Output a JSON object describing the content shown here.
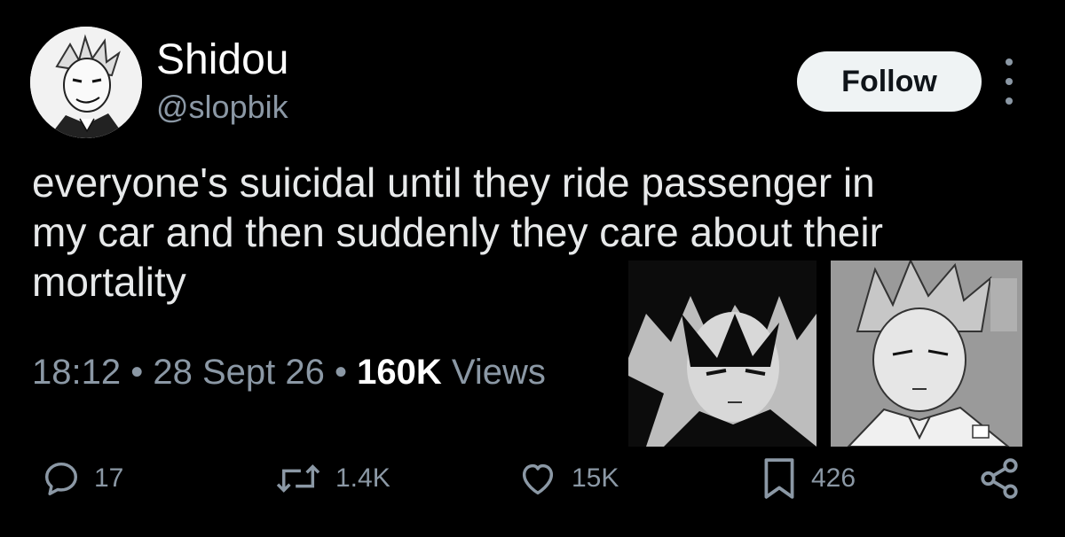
{
  "user": {
    "display_name": "Shidou",
    "handle": "@slopbik",
    "avatar_icon": "manga-avatar"
  },
  "follow_label": "Follow",
  "more_icon": "more-vertical-icon",
  "tweet": {
    "text": "everyone's suicidal until they ride passenger in\nmy car and then suddenly they care about their\nmortality",
    "time": "18:12",
    "separator": "•",
    "date": "28 Sept 26",
    "views_count": "160K",
    "views_label": "Views"
  },
  "actions": {
    "replies": "17",
    "reposts": "1.4K",
    "likes": "15K",
    "bookmarks": "426"
  },
  "colors": {
    "background": "#000000",
    "text": "#e7e9ea",
    "muted": "#8b98a5",
    "button_bg": "#eff3f4"
  }
}
